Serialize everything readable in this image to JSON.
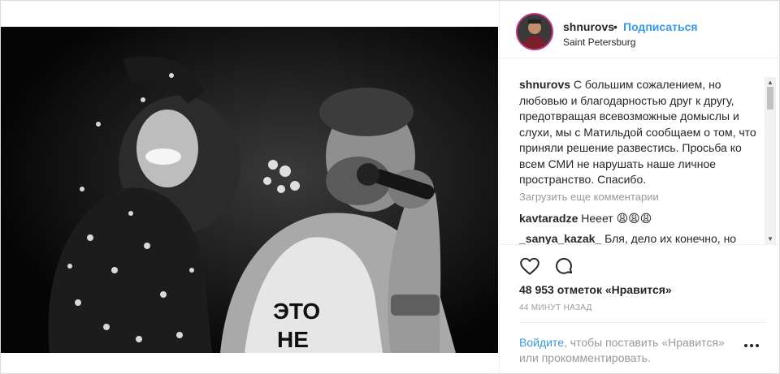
{
  "post": {
    "photo_alt": "",
    "header": {
      "username": "shnurovs",
      "separator": "•",
      "follow_label": "Подписаться",
      "location": "Saint Petersburg"
    },
    "caption": {
      "author": "shnurovs",
      "text": "С большим сожалением, но любовью и благодарностью друг к другу, предотвращая всевозможные домыслы и слухи, мы с Матильдой сообщаем о том, что приняли решение развестись. Просьба ко всем СМИ не нарушать наше личное пространство. Спасибо."
    },
    "load_more_label": "Загрузить еще комментарии",
    "comments": [
      {
        "author": "kavtaradze",
        "text": "Нееет 😩😩😩"
      },
      {
        "author": "_sanya_kazak_",
        "text": "Бля, дело их конечно, но"
      }
    ],
    "likes": "48 953 отметок «Нравится»",
    "time_ago": "44 МИНУТ НАЗАД",
    "login_prompt": {
      "link": "Войдите",
      "rest": ", чтобы поставить «Нравится» или прокомментировать."
    },
    "icons": {
      "like": "heart-icon",
      "comment": "comment-icon",
      "more": "more-options-icon"
    },
    "colors": {
      "link_blue": "#3897f0",
      "avatar_ring": "#c13584",
      "muted_gray": "#999999"
    }
  }
}
